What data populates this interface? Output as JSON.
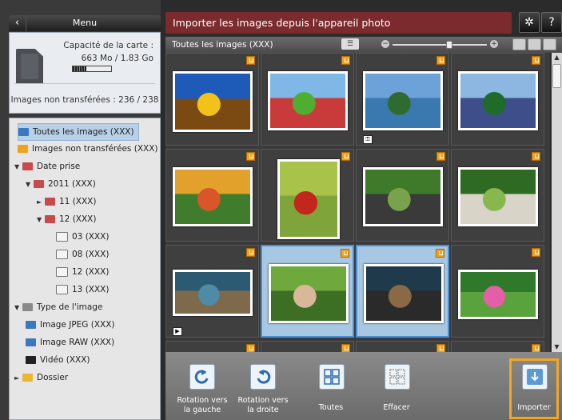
{
  "menu": {
    "title": "Menu",
    "back_icon": "chevron-left-icon"
  },
  "card": {
    "capacity_label": "Capacité de la carte :",
    "capacity_value": "663 Mo /  1.83 Go",
    "usage_fraction": 0.36,
    "untransferred": "Images non transférées : 236 / 238"
  },
  "tree": [
    {
      "label": "Toutes les images (XXX)",
      "icon": "all-images-icon",
      "selected": true
    },
    {
      "label": "Images non transférées (XXX)",
      "icon": "transfer-icon"
    },
    {
      "label": "Date prise",
      "icon": "calendar-icon",
      "arrow": "▼"
    },
    {
      "label": "2011 (XXX)",
      "icon": "calendar-icon",
      "arrow": "▼"
    },
    {
      "label": "11 (XXX)",
      "icon": "calendar-icon",
      "arrow": "►"
    },
    {
      "label": "12 (XXX)",
      "icon": "calendar-icon",
      "arrow": "▼"
    },
    {
      "label": "03 (XXX)",
      "icon": "day-icon"
    },
    {
      "label": "08 (XXX)",
      "icon": "day-icon"
    },
    {
      "label": "12 (XXX)",
      "icon": "day-icon"
    },
    {
      "label": "13 (XXX)",
      "icon": "day-icon"
    },
    {
      "label": "Type de l'image",
      "icon": "image-type-icon",
      "arrow": "▼"
    },
    {
      "label": "Image JPEG (XXX)",
      "icon": "jpeg-icon"
    },
    {
      "label": "Image RAW (XXX)",
      "icon": "raw-icon"
    },
    {
      "label": "Vidéo (XXX)",
      "icon": "video-icon"
    },
    {
      "label": "Dossier",
      "icon": "folder-icon",
      "arrow": "►"
    }
  ],
  "header": {
    "title": "Importer les images depuis l'appareil photo",
    "settings_icon": "gear-icon",
    "help_label": "?"
  },
  "subbar": {
    "label": "Toutes les images (XXX)",
    "zoom_level": 0.6
  },
  "thumbnails": [
    {
      "name": "sunflower",
      "colors": [
        "#1e5bb8",
        "#f2c21b",
        "#7a4a12"
      ],
      "selected": false
    },
    {
      "name": "laundry-meadow",
      "colors": [
        "#7fb8e6",
        "#4fae32",
        "#c93b3b"
      ],
      "selected": false
    },
    {
      "name": "mountain-lake",
      "colors": [
        "#6da2d8",
        "#2f6b2f",
        "#3a78b0"
      ],
      "selected": false,
      "badge": "key"
    },
    {
      "name": "couple-portrait",
      "colors": [
        "#8cb7e0",
        "#1f6b2a",
        "#3d4e8a"
      ],
      "selected": false
    },
    {
      "name": "fruit-market",
      "colors": [
        "#e2a12a",
        "#d8562a",
        "#3f7d2c"
      ],
      "selected": false
    },
    {
      "name": "apples-tomatoes",
      "colors": [
        "#a9c24a",
        "#c2261c",
        "#7fa43a"
      ],
      "selected": false
    },
    {
      "name": "park-bench",
      "colors": [
        "#3e7a2a",
        "#7aa24c",
        "#3a3a3a"
      ],
      "selected": false
    },
    {
      "name": "picnic-park",
      "colors": [
        "#2f6a22",
        "#86b84e",
        "#d8d4c8"
      ],
      "selected": false
    },
    {
      "name": "ducks-water",
      "colors": [
        "#2d5a73",
        "#4f8aa6",
        "#7e6a4a"
      ],
      "selected": false,
      "badge": "video"
    },
    {
      "name": "baby-grass",
      "colors": [
        "#6fa83c",
        "#d9b89a",
        "#3c6e24"
      ],
      "selected": true
    },
    {
      "name": "cat-lying",
      "colors": [
        "#1f3a4a",
        "#8a6a46",
        "#2a2a2a"
      ],
      "selected": true
    },
    {
      "name": "pink-flowers",
      "colors": [
        "#2f7a2a",
        "#e35fa8",
        "#5aa23c"
      ],
      "selected": false
    }
  ],
  "toolbar": {
    "rotate_left": "Rotation vers la gauche",
    "rotate_right": "Rotation vers la droite",
    "select_all": "Toutes",
    "clear": "Effacer",
    "import": "Importer"
  }
}
